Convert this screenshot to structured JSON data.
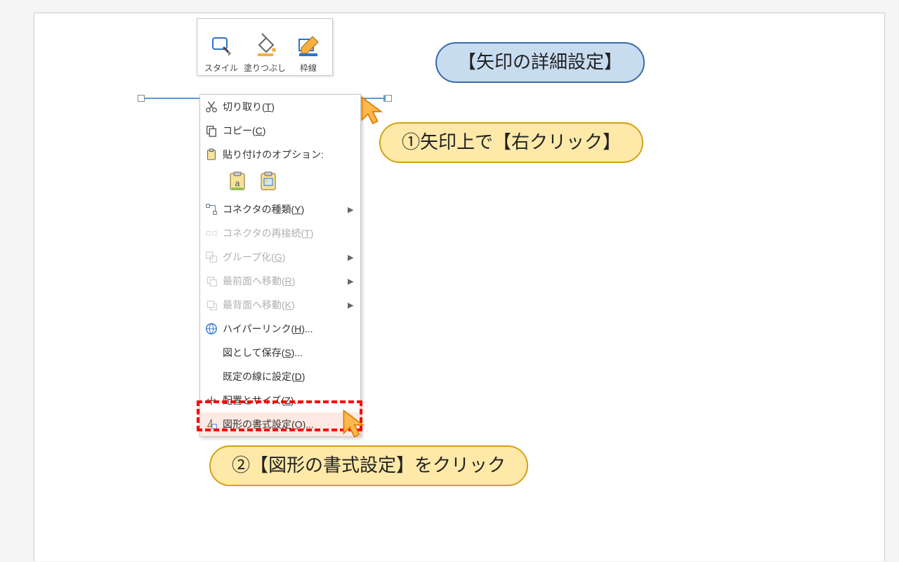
{
  "toolbar": {
    "style": "スタイル",
    "fill": "塗りつぶし",
    "border": "枠線"
  },
  "context_menu": [
    {
      "id": "cut",
      "label": "切り取り",
      "accel": "T",
      "icon": "cut",
      "enabled": true
    },
    {
      "id": "copy",
      "label": "コピー",
      "accel": "C",
      "icon": "copy",
      "enabled": true
    },
    {
      "id": "paste-options",
      "label": "貼り付けのオプション",
      "suffix": ":",
      "icon": "paste",
      "enabled": true
    },
    {
      "id": "paste-opts-row"
    },
    {
      "id": "connector-type",
      "label": "コネクタの種類",
      "accel": "Y",
      "icon": "connector",
      "enabled": true,
      "sub": true
    },
    {
      "id": "reconnect",
      "label": "コネクタの再接続",
      "accel": "T",
      "icon": "reconnect",
      "enabled": false
    },
    {
      "id": "group",
      "label": "グループ化",
      "accel": "G",
      "icon": "group",
      "enabled": false,
      "sub": true
    },
    {
      "id": "bring-front",
      "label": "最前面へ移動",
      "accel": "R",
      "icon": "front",
      "enabled": false,
      "sub": true
    },
    {
      "id": "send-back",
      "label": "最背面へ移動",
      "accel": "K",
      "icon": "back",
      "enabled": false,
      "sub": true
    },
    {
      "id": "hyperlink",
      "label": "ハイパーリンク",
      "accel": "H",
      "suffix": "...",
      "icon": "link",
      "enabled": true
    },
    {
      "id": "save-as-pic",
      "label": "図として保存",
      "accel": "S",
      "suffix": "...",
      "icon": "",
      "enabled": true
    },
    {
      "id": "set-default-line",
      "label": "既定の線に設定",
      "accel": "D",
      "icon": "",
      "enabled": true
    },
    {
      "id": "size-pos",
      "label": "配置とサイズ",
      "accel": "Z",
      "suffix": "...",
      "icon": "sizepos",
      "enabled": true
    },
    {
      "id": "format-shape",
      "label": "図形の書式設定",
      "accel": "O",
      "suffix": "...",
      "icon": "format",
      "enabled": true,
      "highlight": true
    }
  ],
  "balloons": {
    "title": "【矢印の詳細設定】",
    "step1": "①矢印上で【右クリック】",
    "step2": "②【図形の書式設定】をクリック"
  }
}
